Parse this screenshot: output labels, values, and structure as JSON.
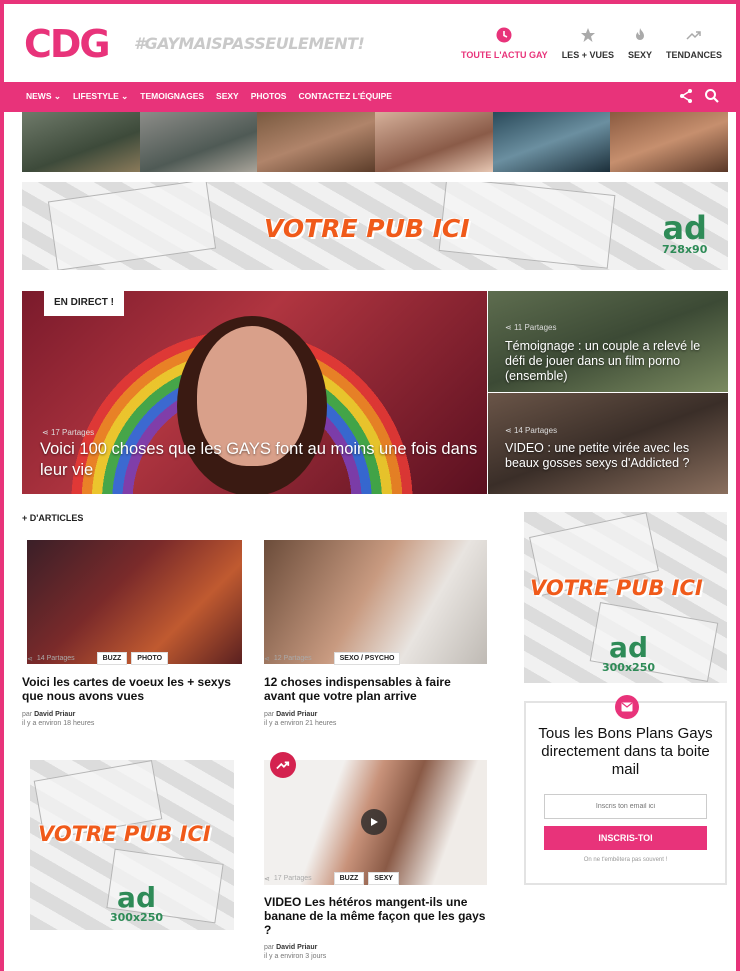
{
  "header": {
    "logo": "CDG",
    "tagline": "#GAYMAISPASSEULEMENT!",
    "nav": [
      {
        "label": "TOUTE L'ACTU GAY",
        "icon": "clock-icon",
        "active": true
      },
      {
        "label": "LES + VUES",
        "icon": "star-icon",
        "active": false
      },
      {
        "label": "SEXY",
        "icon": "flame-icon",
        "active": false
      },
      {
        "label": "TENDANCES",
        "icon": "trending-icon",
        "active": false
      }
    ]
  },
  "menu": {
    "items": [
      "NEWS ⌄",
      "LIFESTYLE ⌄",
      "TEMOIGNAGES",
      "SEXY",
      "PHOTOS",
      "CONTACTEZ L'ÉQUIPE"
    ]
  },
  "ads": {
    "banner": {
      "text": "VOTRE PUB ICI",
      "logo": "ad",
      "size": "728x90"
    },
    "right": {
      "text": "VOTRE PUB ICI",
      "logo": "ad",
      "size": "300x250"
    },
    "left": {
      "text": "VOTRE PUB ICI",
      "logo": "ad",
      "size": "300x250"
    }
  },
  "hero": {
    "badge": "EN DIRECT !",
    "shares": "17 Partages",
    "title": "Voici 100 choses que les GAYS font au moins une fois dans leur vie"
  },
  "side_articles": [
    {
      "shares": "11 Partages",
      "title": "Témoignage : un couple a relevé le défi de jouer dans un film porno (ensemble)"
    },
    {
      "shares": "14 Partages",
      "title": "VIDEO : une petite virée avec les beaux gosses sexys d'Addicted ?"
    }
  ],
  "section": {
    "title": "+ D'ARTICLES"
  },
  "articles": [
    {
      "shares": "14 Partages",
      "tags": [
        "BUZZ",
        "PHOTO"
      ],
      "title": "Voici les cartes de voeux les + sexys que nous avons vues",
      "author_prefix": "par",
      "author": "David Priaur",
      "time": "il y a environ 18 heures"
    },
    {
      "shares": "12 Partages",
      "tags": [
        "SEXO / PSYCHO"
      ],
      "title": "12 choses indispensables à faire avant que votre plan arrive",
      "author_prefix": "par",
      "author": "David Priaur",
      "time": "il y a environ 21 heures"
    },
    {
      "shares": "17 Partages",
      "tags": [
        "BUZZ",
        "SEXY"
      ],
      "title": "VIDEO Les hétéros mangent-ils une banane de la même façon que les gays ?",
      "author_prefix": "par",
      "author": "David Priaur",
      "time": "il y a environ 3 jours"
    }
  ],
  "newsletter": {
    "title": "Tous les Bons Plans Gays directement dans ta boite mail",
    "placeholder": "Inscris ton email ici",
    "button": "INSCRIS-TOI",
    "note": "On ne t'embêtera pas souvent !"
  },
  "colors": {
    "accent": "#e8337a",
    "ad_orange": "#f05a1a",
    "ad_green": "#2e8b57"
  }
}
